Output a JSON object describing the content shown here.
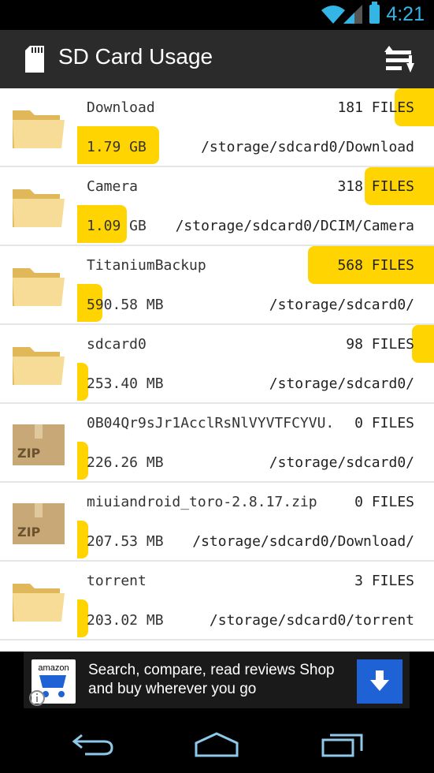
{
  "status": {
    "time": "4:21"
  },
  "toolbar": {
    "title": "SD Card Usage"
  },
  "rows": [
    {
      "icon": "folder",
      "name": "Download",
      "files": "181 FILES",
      "size": "1.79 GB",
      "path": "/storage/sdcard0/Download",
      "files_fill": 0.09,
      "size_fill": 0.23
    },
    {
      "icon": "folder",
      "name": "Camera",
      "files": "318 FILES",
      "size": "1.09 GB",
      "path": "/storage/sdcard0/DCIM/Camera",
      "files_fill": 0.16,
      "size_fill": 0.14
    },
    {
      "icon": "folder",
      "name": "TitaniumBackup",
      "files": "568 FILES",
      "size": "590.58 MB",
      "path": "/storage/sdcard0/",
      "files_fill": 0.29,
      "size_fill": 0.07
    },
    {
      "icon": "folder",
      "name": "sdcard0",
      "files": "98 FILES",
      "size": "253.40 MB",
      "path": "/storage/sdcard0/",
      "files_fill": 0.05,
      "size_fill": 0.03
    },
    {
      "icon": "zip",
      "name": "0B04Qr9sJr1AcclRsNlVYVTFCYVU.",
      "files": "0 FILES",
      "size": "226.26 MB",
      "path": "/storage/sdcard0/",
      "files_fill": 0.0,
      "size_fill": 0.03
    },
    {
      "icon": "zip",
      "name": "miuiandroid_toro-2.8.17.zip",
      "files": "0 FILES",
      "size": "207.53 MB",
      "path": "/storage/sdcard0/Download/",
      "files_fill": 0.0,
      "size_fill": 0.03
    },
    {
      "icon": "folder",
      "name": "torrent",
      "files": "3 FILES",
      "size": "203.02 MB",
      "path": "/storage/sdcard0/torrent",
      "files_fill": 0.0,
      "size_fill": 0.03
    }
  ],
  "ad": {
    "text": "Search, compare, read reviews Shop and buy wherever you go",
    "brand": "amazon"
  },
  "colors": {
    "accent": "#33b5e5",
    "bar": "#ffd400",
    "actionbar": "#2b2b2b"
  }
}
